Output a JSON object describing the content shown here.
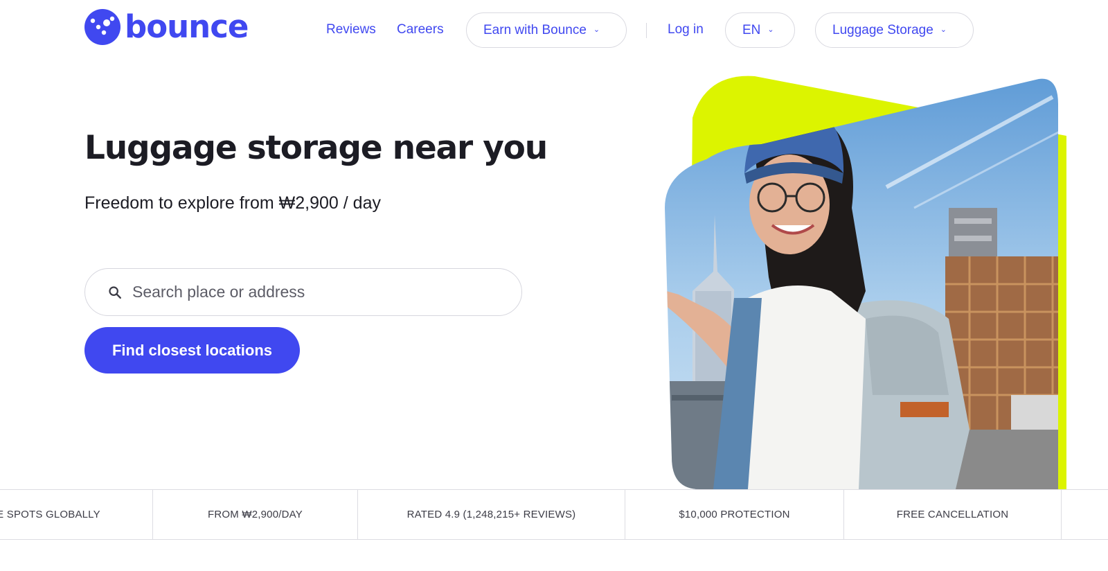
{
  "brand": {
    "name": "bounce",
    "accent": "#4048f0",
    "highlight": "#dcf400"
  },
  "nav": {
    "reviews": "Reviews",
    "careers": "Careers",
    "earn": "Earn with Bounce",
    "login": "Log in",
    "language": "EN",
    "luggage_storage": "Luggage Storage"
  },
  "hero": {
    "title": "Luggage storage near you",
    "subtitle": "Freedom to explore from ₩2,900 / day",
    "search_placeholder": "Search place or address",
    "cta_label": "Find closest locations",
    "image_icon": "traveler-photo"
  },
  "features": [
    "E SPOTS GLOBALLY",
    "FROM ₩2,900/DAY",
    "RATED 4.9 (1,248,215+ REVIEWS)",
    "$10,000 PROTECTION",
    "FREE CANCELLATION"
  ]
}
